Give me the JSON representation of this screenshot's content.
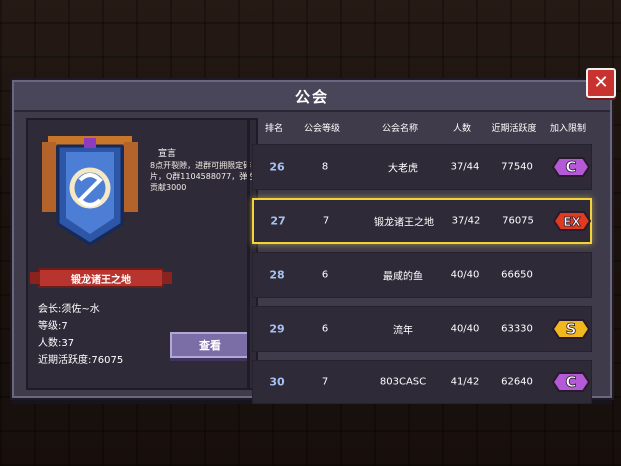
{
  "dialog": {
    "title": "公会",
    "close_icon": "close-icon"
  },
  "guild": {
    "declaration_title": "宣言",
    "declaration_text": "8点开裂隙，进群可拥限定碎片，Q群1104588077，弹性贡献3000",
    "name": "锻龙诸王之地",
    "leader": "会长:须佐~水",
    "level": "等级:7",
    "members": "人数:37",
    "activity": "近期活跃度:76075",
    "view_button": "查看"
  },
  "table": {
    "headers": [
      "排名",
      "公会等级",
      "公会名称",
      "人数",
      "近期活跃度",
      "加入限制"
    ],
    "rows": [
      {
        "rank": "26",
        "level": "8",
        "name": "大老虎",
        "members": "37/44",
        "activity": "77540",
        "badge": "C",
        "badge_color": "#b45ad6",
        "selected": false
      },
      {
        "rank": "27",
        "level": "7",
        "name": "锻龙诸王之地",
        "members": "37/42",
        "activity": "76075",
        "badge": "EX",
        "badge_color": "#e03a1f",
        "selected": true
      },
      {
        "rank": "28",
        "level": "6",
        "name": "最咸的鱼",
        "members": "40/40",
        "activity": "66650",
        "badge": "",
        "badge_color": "",
        "selected": false
      },
      {
        "rank": "29",
        "level": "6",
        "name": "流年",
        "members": "40/40",
        "activity": "63330",
        "badge": "S",
        "badge_color": "#f0b81e",
        "selected": false
      },
      {
        "rank": "30",
        "level": "7",
        "name": "803CASC",
        "members": "41/42",
        "activity": "62640",
        "badge": "C",
        "badge_color": "#b45ad6",
        "selected": false
      }
    ]
  }
}
